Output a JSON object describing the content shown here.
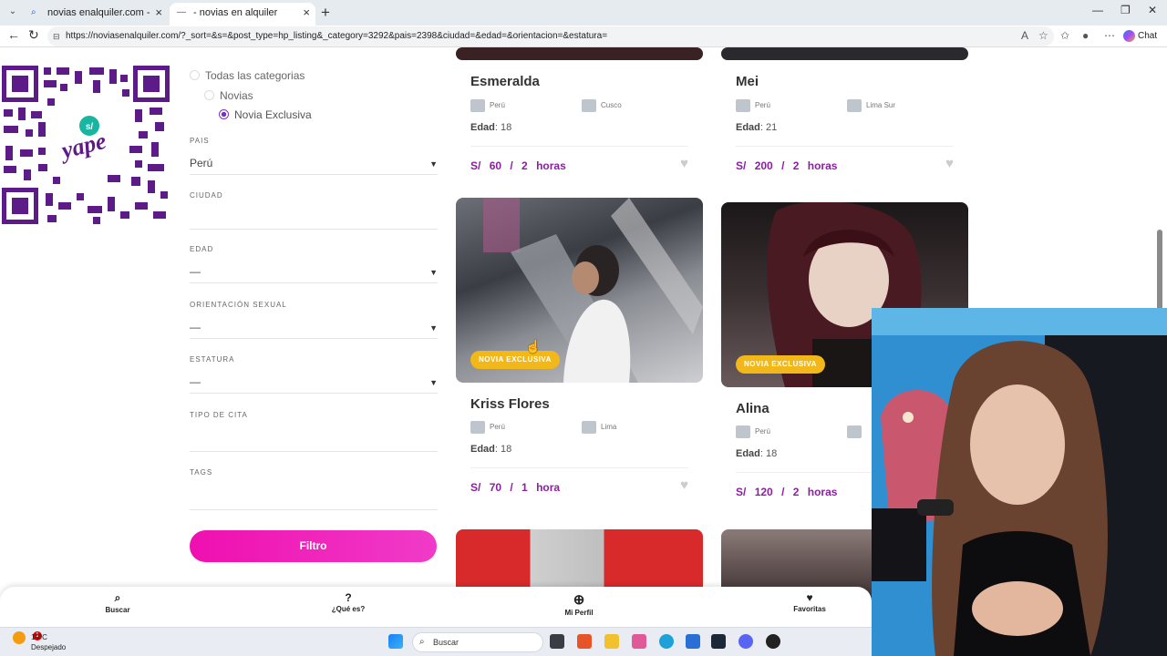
{
  "browser": {
    "tabs": [
      {
        "title": "novias enalquiler.com - Búsqueda",
        "active": false
      },
      {
        "title": "- novias en alquiler",
        "active": true
      }
    ],
    "url": "https://noviasenalquiler.com/?_sort=&s=&post_type=hp_listing&_category=3292&pais=2398&ciudad=&edad=&orientacion=&estatura=",
    "chat_label": "Chat"
  },
  "filters": {
    "categories": [
      {
        "label": "Todas las categorias",
        "checked": false
      },
      {
        "label": "Novias",
        "checked": false
      },
      {
        "label": "Novia Exclusiva",
        "checked": true
      }
    ],
    "fields": [
      {
        "label": "PAIS",
        "value": ""
      },
      {
        "label": "CIUDAD",
        "value": ""
      },
      {
        "label": "EDAD",
        "value": "—"
      },
      {
        "label": "ORIENTACIÓN SEXUAL",
        "value": "—"
      },
      {
        "label": "ESTATURA",
        "value": "—"
      },
      {
        "label": "TIPO DE CITA",
        "value": ""
      },
      {
        "label": "TAGS",
        "value": ""
      }
    ],
    "pais_value": "Perú",
    "button": "Filtro"
  },
  "listings": [
    {
      "name": "Esmeralda",
      "country": "Perú",
      "city": "Cusco",
      "age_label": "Edad",
      "age": "18",
      "currency": "S/",
      "price": "60",
      "duration": "/ 2 horas"
    },
    {
      "name": "Mei",
      "country": "Perú",
      "city": "Lima Sur",
      "age_label": "Edad",
      "age": "21",
      "currency": "S/",
      "price": "200",
      "duration": "/ 2 horas"
    },
    {
      "name": "Kriss Flores",
      "badge": "NOVIA EXCLUSIVA",
      "country": "Perú",
      "city": "Lima",
      "age_label": "Edad",
      "age": "18",
      "currency": "S/",
      "price": "70",
      "duration": "/ 1 hora"
    },
    {
      "name": "Alina",
      "badge": "NOVIA EXCLUSIVA",
      "country": "Perú",
      "city": "",
      "age_label": "Edad",
      "age": "18",
      "currency": "S/",
      "price": "120",
      "duration": "/ 2 horas"
    }
  ],
  "bottom_nav": [
    {
      "label": "Buscar",
      "icon": "search-icon"
    },
    {
      "label": "¿Qué es?",
      "icon": "question-icon"
    },
    {
      "label": "Mi Perfil",
      "icon": "plus-circle-icon"
    },
    {
      "label": "Favoritas",
      "icon": "heart-icon"
    }
  ],
  "taskbar": {
    "temp": "10°C",
    "condition": "Despejado",
    "alert_count": "1",
    "search_placeholder": "Buscar"
  },
  "colors": {
    "accent": "#8a1fa0",
    "button_pink": "#ef0fb0",
    "badge_yellow": "#f2b81a",
    "qr_purple": "#5c1b87"
  }
}
